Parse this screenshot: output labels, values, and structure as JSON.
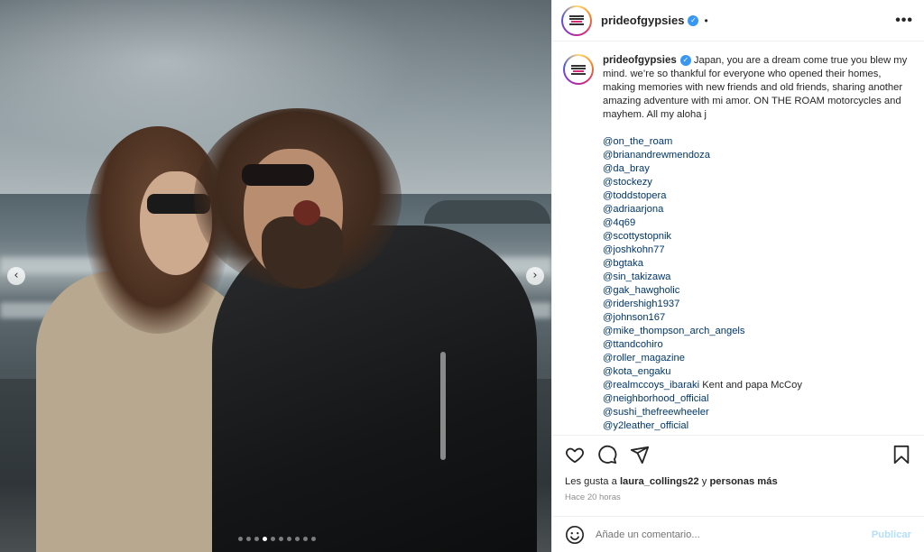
{
  "post": {
    "username": "prideofgypsies",
    "more_label": "•••",
    "separator": "•",
    "caption": "Japan, you are a dream come true you blew my mind. we’re so thankful for everyone who opened their homes, making memories with new friends and old friends, sharing another amazing adventure with mi amor. ON THE ROAM motorcycles and mayhem. All my aloha j",
    "tags": [
      {
        "handle": "@on_the_roam",
        "extra": ""
      },
      {
        "handle": "@brianandrewmendoza",
        "extra": ""
      },
      {
        "handle": "@da_bray",
        "extra": ""
      },
      {
        "handle": "@stockezy",
        "extra": ""
      },
      {
        "handle": "@toddstopera",
        "extra": ""
      },
      {
        "handle": "@adriaarjona",
        "extra": ""
      },
      {
        "handle": "@4q69",
        "extra": ""
      },
      {
        "handle": "@scottystopnik",
        "extra": ""
      },
      {
        "handle": "@joshkohn77",
        "extra": ""
      },
      {
        "handle": "@bgtaka",
        "extra": ""
      },
      {
        "handle": "@sin_takizawa",
        "extra": ""
      },
      {
        "handle": "@gak_hawgholic",
        "extra": ""
      },
      {
        "handle": "@ridershigh1937",
        "extra": ""
      },
      {
        "handle": "@johnson167",
        "extra": ""
      },
      {
        "handle": "@mike_thompson_arch_angels",
        "extra": ""
      },
      {
        "handle": "@ttandcohiro",
        "extra": ""
      },
      {
        "handle": "@roller_magazine",
        "extra": ""
      },
      {
        "handle": "@kota_engaku",
        "extra": ""
      },
      {
        "handle": "@realmccoys_ibaraki",
        "extra": " Kent and papa McCoy"
      },
      {
        "handle": "@neighborhood_official",
        "extra": ""
      },
      {
        "handle": "@sushi_thefreewheeler",
        "extra": ""
      },
      {
        "handle": "@y2leather_official",
        "extra": ""
      }
    ],
    "likes_prefix": "Les gusta a ",
    "likes_user": "laura_collings22",
    "likes_middle": " y ",
    "likes_suffix": "personas más",
    "time_ago": "Hace 20 horas",
    "comment_placeholder": "Añade un comentario...",
    "post_button": "Publicar",
    "carousel_total": 10,
    "carousel_active": 3
  },
  "nav": {
    "prev": "‹",
    "next": "›"
  },
  "icons": [
    "heart-icon",
    "comment-icon",
    "share-icon",
    "bookmark-icon",
    "emoji-icon",
    "verified-icon",
    "more-icon"
  ]
}
